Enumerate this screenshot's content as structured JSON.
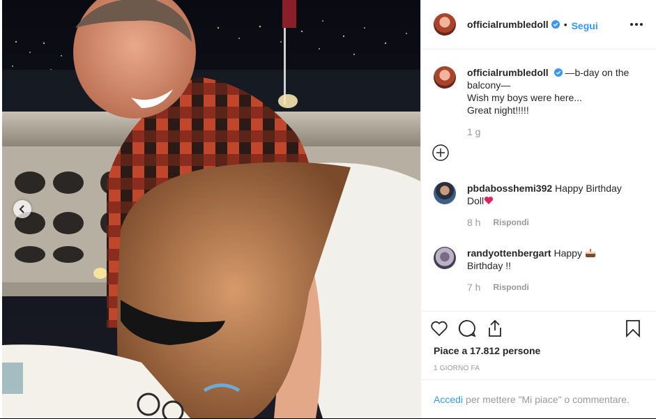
{
  "post": {
    "username": "officialrumbledoll",
    "follow_label": "Segui",
    "dot": "•"
  },
  "caption": {
    "username": "officialrumbledoll",
    "text_line1": "—b-day on the balcony—",
    "text_line2": "Wish my boys were here...",
    "text_line3": "Great night!!!!!",
    "time": "1 g"
  },
  "comments": [
    {
      "username": "pbdabosshemi392",
      "text": "Happy Birthday Doll",
      "emoji": "heart",
      "time": "8 h",
      "reply": "Rispondi"
    },
    {
      "username": "randyottenbergart",
      "text_before": "Happy",
      "text_after": "Birthday !!",
      "emoji": "cake",
      "time": "7 h",
      "reply": "Rispondi"
    }
  ],
  "likes": {
    "text": "Piace a 17.812 persone"
  },
  "date": "1 GIORNO FA",
  "login": {
    "link": "Accedi",
    "text": "per mettere \"Mi piace\" o commentare."
  },
  "colors": {
    "accent": "#3897f0",
    "verified": "#3897f0",
    "muted": "#999999"
  }
}
